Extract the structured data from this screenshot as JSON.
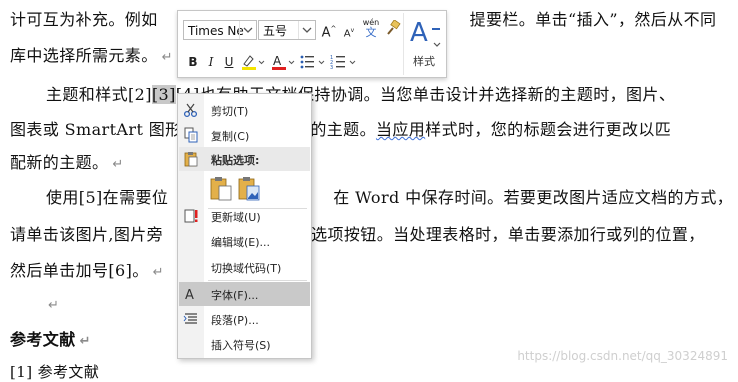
{
  "document": {
    "line1_a": "计可互为补充。例如",
    "line1_b": "提要栏。单击“插入”，然后从不同",
    "line2": "库中选择所需元素。",
    "line3_a": "主题和样式[2]",
    "line3_sel": "[3]",
    "line3_b": "[4]也有助于文档保持协调。当您单击设计并选择新的主题时，图片、",
    "line4_a": "图表或 SmartArt 图形",
    "line4_b": "的新的主题。",
    "line4_squiggle": "当应用",
    "line4_c": "样式时，您的标题会进行更改以匹",
    "line5": "配新的主题。",
    "line6_a": "使用[5]在需要位",
    "line6_b": "在 Word 中保存时间。若要更改图片适应文档的方式，",
    "line7_a": "请单击该图片,图片旁",
    "line7_b": "选项按钮。当处理表格时，单击要添加行或列的位置，",
    "line8": "然后单击加号[6]。",
    "refs_heading": "参考文献",
    "ref1": "[1]  参考文献",
    "para_mark": "↵"
  },
  "watermark": "https://blog.csdn.net/qq_30324891",
  "toolbar": {
    "font_name": "Times Ne",
    "font_size": "五号",
    "grow_font": "A",
    "shrink_font": "A",
    "phonetic": "wén",
    "bold": "B",
    "italic": "I",
    "underline": "U",
    "styles_label": "样式",
    "highlight_color": "#f5e400",
    "font_color": "#e02020"
  },
  "context_menu": {
    "items": [
      {
        "label": "剪切(T)",
        "icon": "scissors-icon"
      },
      {
        "label": "复制(C)",
        "icon": "copy-icon"
      },
      {
        "label": "粘贴选项:",
        "icon": "clipboard-icon"
      },
      {
        "label": "更新域(U)",
        "icon": "update-field-icon"
      },
      {
        "label": "编辑域(E)...",
        "icon": ""
      },
      {
        "label": "切换域代码(T)",
        "icon": ""
      },
      {
        "label": "字体(F)...",
        "icon": "font-icon"
      },
      {
        "label": "段落(P)...",
        "icon": "paragraph-icon"
      },
      {
        "label": "插入符号(S)",
        "icon": ""
      }
    ]
  }
}
